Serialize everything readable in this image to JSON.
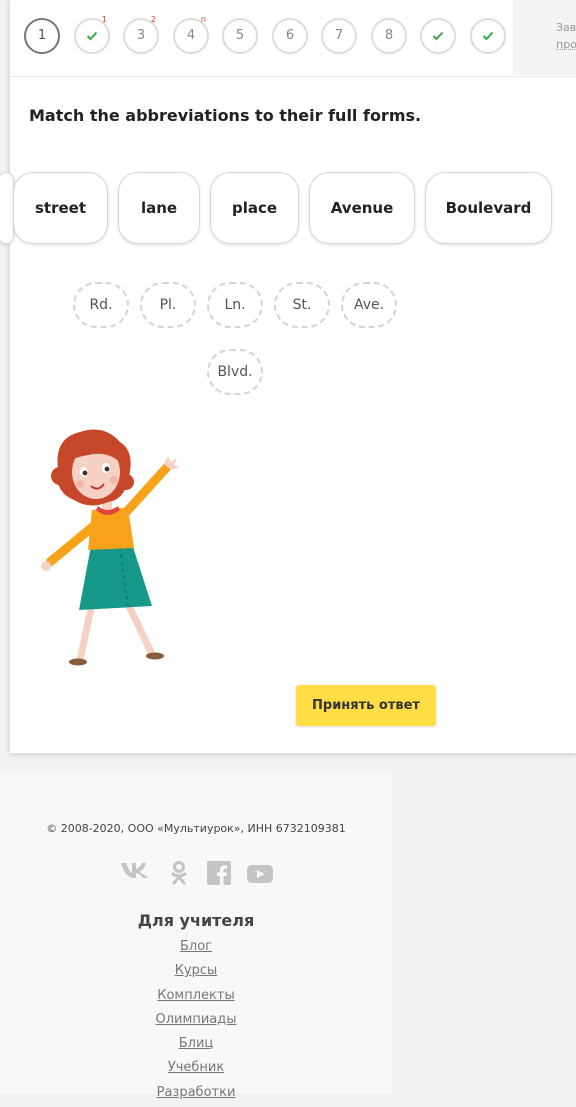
{
  "steps": [
    {
      "label": "1",
      "state": "current",
      "sup": ""
    },
    {
      "label": "",
      "state": "done",
      "sup": "1"
    },
    {
      "label": "3",
      "state": "pending",
      "sup": "2"
    },
    {
      "label": "4",
      "state": "pending",
      "sup": "п"
    },
    {
      "label": "5",
      "state": "pending",
      "sup": ""
    },
    {
      "label": "6",
      "state": "pending",
      "sup": ""
    },
    {
      "label": "7",
      "state": "pending",
      "sup": ""
    },
    {
      "label": "8",
      "state": "pending",
      "sup": ""
    },
    {
      "label": "",
      "state": "done",
      "sup": ""
    },
    {
      "label": "",
      "state": "done",
      "sup": ""
    }
  ],
  "side_panel": {
    "line1": "Зав",
    "line2": "про"
  },
  "task": {
    "title": "Match the abbreviations to their full forms."
  },
  "words": [
    "street",
    "lane",
    "place",
    "Avenue",
    "Boulevard"
  ],
  "abbreviations": [
    "Rd.",
    "Pl.",
    "Ln.",
    "St.",
    "Ave.",
    "Blvd."
  ],
  "accept_button": "Принять ответ",
  "footer": {
    "copyright": "© 2008-2020, ООО «Мультиурок», ИНН 6732109381",
    "social_icons": [
      "vk-icon",
      "odnoklassniki-icon",
      "facebook-icon",
      "youtube-icon"
    ],
    "section_title": "Для учителя",
    "links": [
      "Блог",
      "Курсы",
      "Комплекты",
      "Олимпиады",
      "Блиц",
      "Учебник",
      "Разработки"
    ]
  },
  "colors": {
    "check": "#3aa844",
    "accent_button": "#ffdd44",
    "superscript": "#e53935"
  }
}
